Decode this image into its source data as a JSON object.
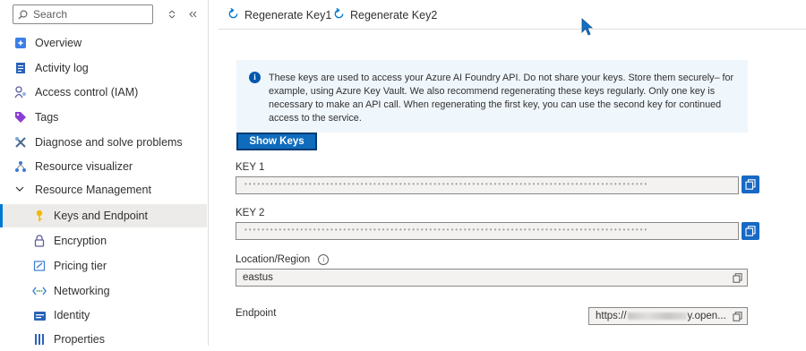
{
  "search": {
    "placeholder": "Search"
  },
  "sidebar": {
    "items": [
      {
        "label": "Overview",
        "icon": "overview-icon"
      },
      {
        "label": "Activity log",
        "icon": "activity-log-icon"
      },
      {
        "label": "Access control (IAM)",
        "icon": "access-control-icon"
      },
      {
        "label": "Tags",
        "icon": "tag-icon"
      },
      {
        "label": "Diagnose and solve problems",
        "icon": "wrench-icon"
      },
      {
        "label": "Resource visualizer",
        "icon": "resource-visualizer-icon"
      }
    ],
    "group": {
      "label": "Resource Management",
      "items": [
        {
          "label": "Keys and Endpoint",
          "icon": "key-icon",
          "selected": true
        },
        {
          "label": "Encryption",
          "icon": "lock-icon"
        },
        {
          "label": "Pricing tier",
          "icon": "pricing-tier-icon"
        },
        {
          "label": "Networking",
          "icon": "networking-icon"
        },
        {
          "label": "Identity",
          "icon": "identity-icon"
        },
        {
          "label": "Properties",
          "icon": "properties-icon"
        }
      ]
    }
  },
  "toolbar": {
    "regenerate_key1": "Regenerate Key1",
    "regenerate_key2": "Regenerate Key2"
  },
  "info": {
    "text": "These keys are used to access your Azure AI Foundry API. Do not share your keys. Store them securely– for example, using Azure Key Vault. We also recommend regenerating these keys regularly. Only one key is necessary to make an API call. When regenerating the first key, you can use the second key for continued access to the service."
  },
  "show_keys_label": "Show Keys",
  "fields": {
    "key1_label": "KEY 1",
    "key1_value": "••••••••••••••••••••••••••••••••••••••••••••••••••••••••••••••••••••••••••••••••••••••••••••••",
    "key2_label": "KEY 2",
    "key2_value": "••••••••••••••••••••••••••••••••••••••••••••••••••••••••••••••••••••••••••••••••••••••••••••••",
    "location_label": "Location/Region",
    "location_value": "eastus",
    "endpoint_label": "Endpoint",
    "endpoint_prefix": "https://",
    "endpoint_suffix": "y.open..."
  },
  "colors": {
    "accent": "#0078d4",
    "button": "#0f6cbd",
    "info_bg": "#eff6fc"
  }
}
